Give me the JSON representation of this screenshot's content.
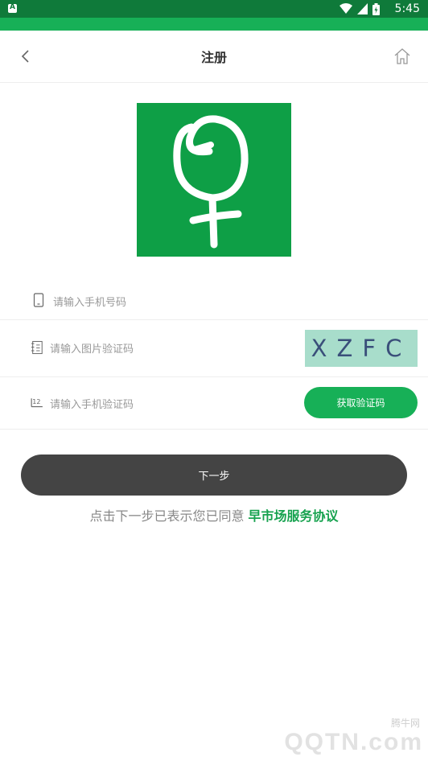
{
  "status_bar": {
    "time": "5:45"
  },
  "header": {
    "title": "注册"
  },
  "form": {
    "phone_placeholder": "请输入手机号码",
    "image_code_placeholder": "请输入图片验证码",
    "captcha_text": "XZFC",
    "sms_code_placeholder": "请输入手机验证码",
    "get_code_label": "获取验证码"
  },
  "next_label": "下一步",
  "agreement": {
    "prefix": "点击下一步已表示您已同意",
    "link": "早市场服务协议"
  },
  "watermark": {
    "small": "腾牛网",
    "big": "QQTN.com"
  },
  "colors": {
    "brand": "#17b057",
    "status_bar": "#0f7a3a",
    "button_dark": "#444444"
  }
}
